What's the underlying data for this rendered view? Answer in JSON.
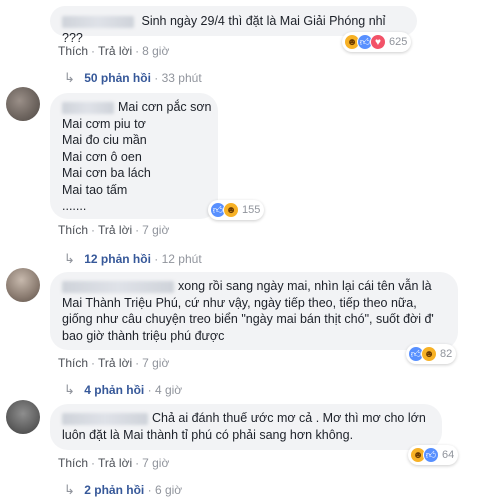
{
  "comments": [
    {
      "text_lines": [
        "Sinh ngày 29/4 thì đặt là Mai Giải Phóng nhỉ ???"
      ],
      "like_label": "Thích",
      "reply_label": "Trả lời",
      "time": "8 giờ",
      "reaction_count": "625",
      "reactions": [
        "haha-icon",
        "like-icon",
        "love-icon"
      ],
      "replies_label": "50 phản hồi",
      "replies_time": "33 phút"
    },
    {
      "text_lines": [
        "Mai cơn pắc sơn",
        "Mai cơm piu tơ",
        "Mai đo ciu mần",
        "Mai cơn ô oen",
        "Mai cơn ba lách",
        "Mai tao tấm",
        "......."
      ],
      "like_label": "Thích",
      "reply_label": "Trả lời",
      "time": "7 giờ",
      "reaction_count": "155",
      "reactions": [
        "like-icon",
        "haha-icon"
      ],
      "replies_label": "12 phản hồi",
      "replies_time": "12 phút"
    },
    {
      "text_lines": [
        "xong rồi sang ngày mai, nhìn lại cái tên vẫn là",
        "Mai Thành Triệu Phú, cứ như vậy, ngày tiếp theo, tiếp theo nữa,",
        "giống như câu chuyện treo biển \"ngày mai bán thịt chó\", suốt đời đ'",
        "bao giờ thành triệu phú được"
      ],
      "like_label": "Thích",
      "reply_label": "Trả lời",
      "time": "7 giờ",
      "reaction_count": "82",
      "reactions": [
        "like-icon",
        "haha-icon"
      ],
      "replies_label": "4 phản hồi",
      "replies_time": "4 giờ"
    },
    {
      "text_lines": [
        "Chả ai đánh thuế ước mơ cả . Mơ thì mơ cho lớn",
        "luôn đặt là Mai thành tỉ phú có phải sang hơn không."
      ],
      "like_label": "Thích",
      "reply_label": "Trả lời",
      "time": "7 giờ",
      "reaction_count": "64",
      "reactions": [
        "haha-icon",
        "like-icon"
      ],
      "replies_label": "2 phản hồi",
      "replies_time": "6 giờ"
    }
  ]
}
